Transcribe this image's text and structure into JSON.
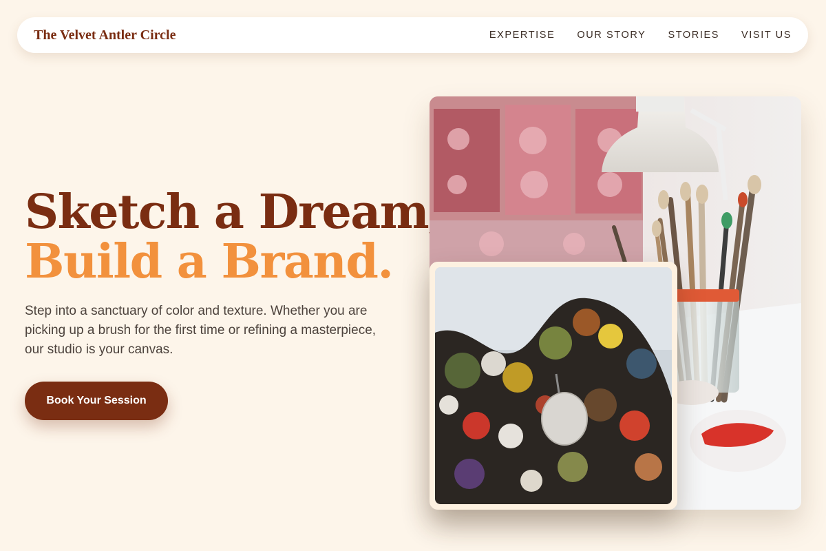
{
  "nav": {
    "brand": "The Velvet Antler Circle",
    "links": [
      "EXPERTISE",
      "OUR STORY",
      "STORIES",
      "VISIT US"
    ]
  },
  "hero": {
    "title_line1": "Sketch a Dream,",
    "title_line2": "Build a Brand.",
    "subtitle": "Step into a sanctuary of color and texture. Whether you are picking up a brush for the first time or refining a masterpiece, our studio is your canvas.",
    "cta_label": "Book Your Session"
  },
  "colors": {
    "background": "#fdf5ea",
    "brand_dark": "#7a2d12",
    "accent_orange": "#f2913d"
  },
  "images": {
    "main": "studio-brushes-lamp-photo",
    "inset": "paint-palette-photo"
  }
}
